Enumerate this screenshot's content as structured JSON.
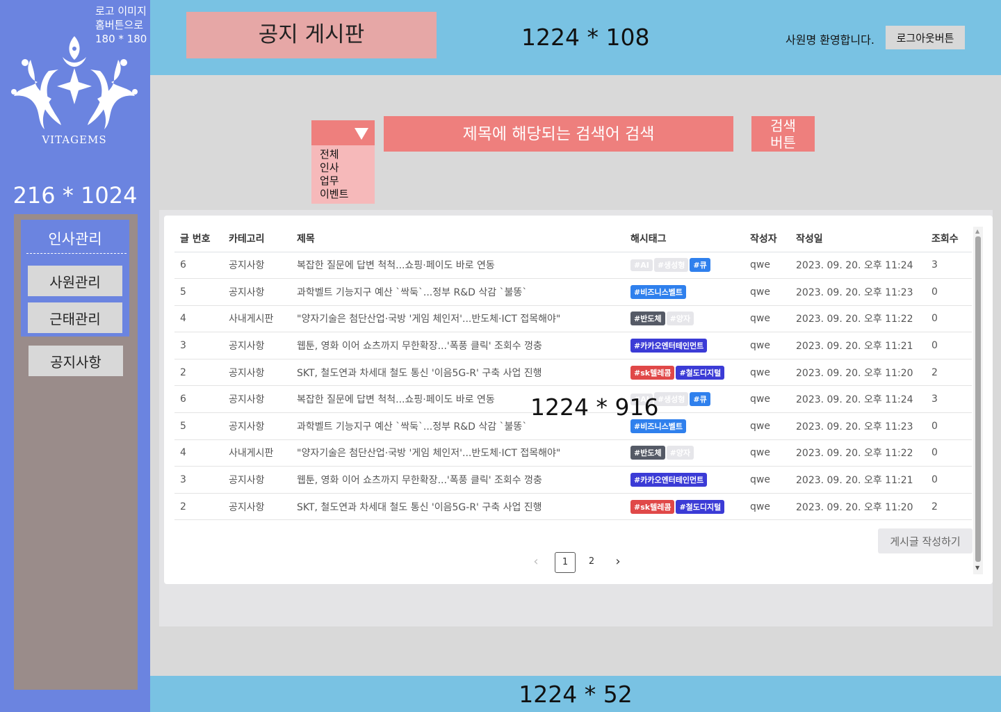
{
  "sidebar": {
    "logo_note": [
      "로고 이미지",
      "홈버튼으로",
      "180 * 180"
    ],
    "logo_text": "VITAGEMS",
    "size_label": "216 * 1024",
    "group_title": "인사관리",
    "items": [
      {
        "label": "사원관리"
      },
      {
        "label": "근태관리"
      },
      {
        "label": "공지사항"
      }
    ]
  },
  "header": {
    "title": "공지 게시판",
    "size_label": "1224 * 108",
    "welcome": "사원명 환영합니다.",
    "logout_label": "로그아웃버튼"
  },
  "search": {
    "options": [
      "전체",
      "인사",
      "업무",
      "이벤트"
    ],
    "placeholder": "제목에 해당되는 검색어 검색",
    "button_label": "검색\n버튼"
  },
  "board": {
    "columns": [
      "글 번호",
      "카테고리",
      "제목",
      "해시태그",
      "작성자",
      "작성일",
      "조회수"
    ],
    "rows": [
      {
        "no": "6",
        "category": "공지사항",
        "title": "복잡한 질문에 답변 척척...쇼핑·페이도 바로 연동",
        "tags": [
          {
            "text": "#AI",
            "color": "#e6e6ea"
          },
          {
            "text": "#생성형",
            "color": "#e6e6ea"
          },
          {
            "text": "#큐",
            "color": "#2f80ed"
          }
        ],
        "author": "qwe",
        "date": "2023. 09. 20. 오후 11:24",
        "views": "3"
      },
      {
        "no": "5",
        "category": "공지사항",
        "title": "과학벨트 기능지구 예산 `싹둑`...정부 R&D 삭감 `불똥`",
        "tags": [
          {
            "text": "#비즈니스벨트",
            "color": "#2f80ed"
          }
        ],
        "author": "qwe",
        "date": "2023. 09. 20. 오후 11:23",
        "views": "0"
      },
      {
        "no": "4",
        "category": "사내게시판",
        "title": "\"양자기술은 첨단산업·국방 '게임 체인저'...반도체·ICT 접목해야\"",
        "tags": [
          {
            "text": "#반도체",
            "color": "#555a66"
          },
          {
            "text": "#양자",
            "color": "#e6e6ea"
          }
        ],
        "author": "qwe",
        "date": "2023. 09. 20. 오후 11:22",
        "views": "0"
      },
      {
        "no": "3",
        "category": "공지사항",
        "title": "웹툰, 영화 이어 쇼츠까지 무한확장...'폭풍 클릭' 조회수 껑충",
        "tags": [
          {
            "text": "#카카오엔터테인먼트",
            "color": "#3b3bd6"
          }
        ],
        "author": "qwe",
        "date": "2023. 09. 20. 오후 11:21",
        "views": "0"
      },
      {
        "no": "2",
        "category": "공지사항",
        "title": "SKT, 철도연과 차세대 철도 통신 '이음5G-R' 구축 사업 진행",
        "tags": [
          {
            "text": "#sk텔레콤",
            "color": "#e04848"
          },
          {
            "text": "#철도디지털",
            "color": "#3b3bd6"
          }
        ],
        "author": "qwe",
        "date": "2023. 09. 20. 오후 11:20",
        "views": "2"
      },
      {
        "no": "6",
        "category": "공지사항",
        "title": "복잡한 질문에 답변 척척...쇼핑·페이도 바로 연동",
        "tags": [
          {
            "text": "#AI",
            "color": "#e6e6ea"
          },
          {
            "text": "#생성형",
            "color": "#e6e6ea"
          },
          {
            "text": "#큐",
            "color": "#2f80ed"
          }
        ],
        "author": "qwe",
        "date": "2023. 09. 20. 오후 11:24",
        "views": "3"
      },
      {
        "no": "5",
        "category": "공지사항",
        "title": "과학벨트 기능지구 예산 `싹둑`...정부 R&D 삭감 `불똥`",
        "tags": [
          {
            "text": "#비즈니스벨트",
            "color": "#2f80ed"
          }
        ],
        "author": "qwe",
        "date": "2023. 09. 20. 오후 11:23",
        "views": "0"
      },
      {
        "no": "4",
        "category": "사내게시판",
        "title": "\"양자기술은 첨단산업·국방 '게임 체인저'...반도체·ICT 접목해야\"",
        "tags": [
          {
            "text": "#반도체",
            "color": "#555a66"
          },
          {
            "text": "#양자",
            "color": "#e6e6ea"
          }
        ],
        "author": "qwe",
        "date": "2023. 09. 20. 오후 11:22",
        "views": "0"
      },
      {
        "no": "3",
        "category": "공지사항",
        "title": "웹툰, 영화 이어 쇼츠까지 무한확장...'폭풍 클릭' 조회수 껑충",
        "tags": [
          {
            "text": "#카카오엔터테인먼트",
            "color": "#3b3bd6"
          }
        ],
        "author": "qwe",
        "date": "2023. 09. 20. 오후 11:21",
        "views": "0"
      },
      {
        "no": "2",
        "category": "공지사항",
        "title": "SKT, 철도연과 차세대 철도 통신 '이음5G-R' 구축 사업 진행",
        "tags": [
          {
            "text": "#sk텔레콤",
            "color": "#e04848"
          },
          {
            "text": "#철도디지털",
            "color": "#3b3bd6"
          }
        ],
        "author": "qwe",
        "date": "2023. 09. 20. 오후 11:20",
        "views": "2"
      }
    ],
    "write_label": "게시글 작성하기",
    "pagination": {
      "prev": "‹",
      "pages": [
        "1",
        "2"
      ],
      "current": "1",
      "next": "›"
    },
    "size_label": "1224 * 916"
  },
  "footer": {
    "size_label": "1224 * 52"
  }
}
